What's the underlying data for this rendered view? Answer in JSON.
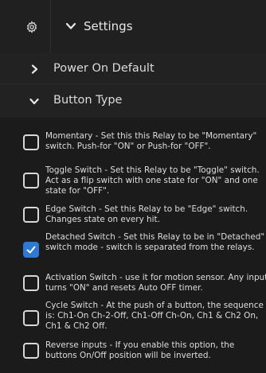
{
  "header": {
    "title": "Settings",
    "icon": "gear-icon"
  },
  "sections": [
    {
      "label": "Power On Default",
      "expanded": false
    },
    {
      "label": "Button Type",
      "expanded": true
    }
  ],
  "options": [
    {
      "text": "Momentary - Set this this Relay to be \"Momentary\" switch. Push-for \"ON\" or Push-for \"OFF\".",
      "checked": false
    },
    {
      "text": "Toggle Switch - Set this Relay to be \"Toggle\" switch. Act as a flip switch with one state for \"ON\" and one state for \"OFF\".",
      "checked": false
    },
    {
      "text": "Edge Switch - Set this Relay to be \"Edge\" switch. Changes state on every hit.",
      "checked": false
    },
    {
      "text": "Detached Switch - Set this Relay to be in \"Detached\" switch mode - switch is separated from the relays.",
      "checked": true
    },
    {
      "text": "Activation Switch - use it for motion sensor. Any input turns \"ON\" and resets Auto OFF timer.",
      "checked": false
    },
    {
      "text": "Cycle Switch - At the push of a button, the sequence is: Ch1-On Ch-2-Off, Ch1-Off Ch-On, Ch1 & Ch2 On, Ch1 & Ch2 Off.",
      "checked": false
    },
    {
      "text": "Reverse inputs - If you enable this option, the buttons On/Off position will be inverted.",
      "checked": false
    }
  ],
  "colors": {
    "accent": "#2f79d6",
    "background": "#1b1b1b"
  }
}
